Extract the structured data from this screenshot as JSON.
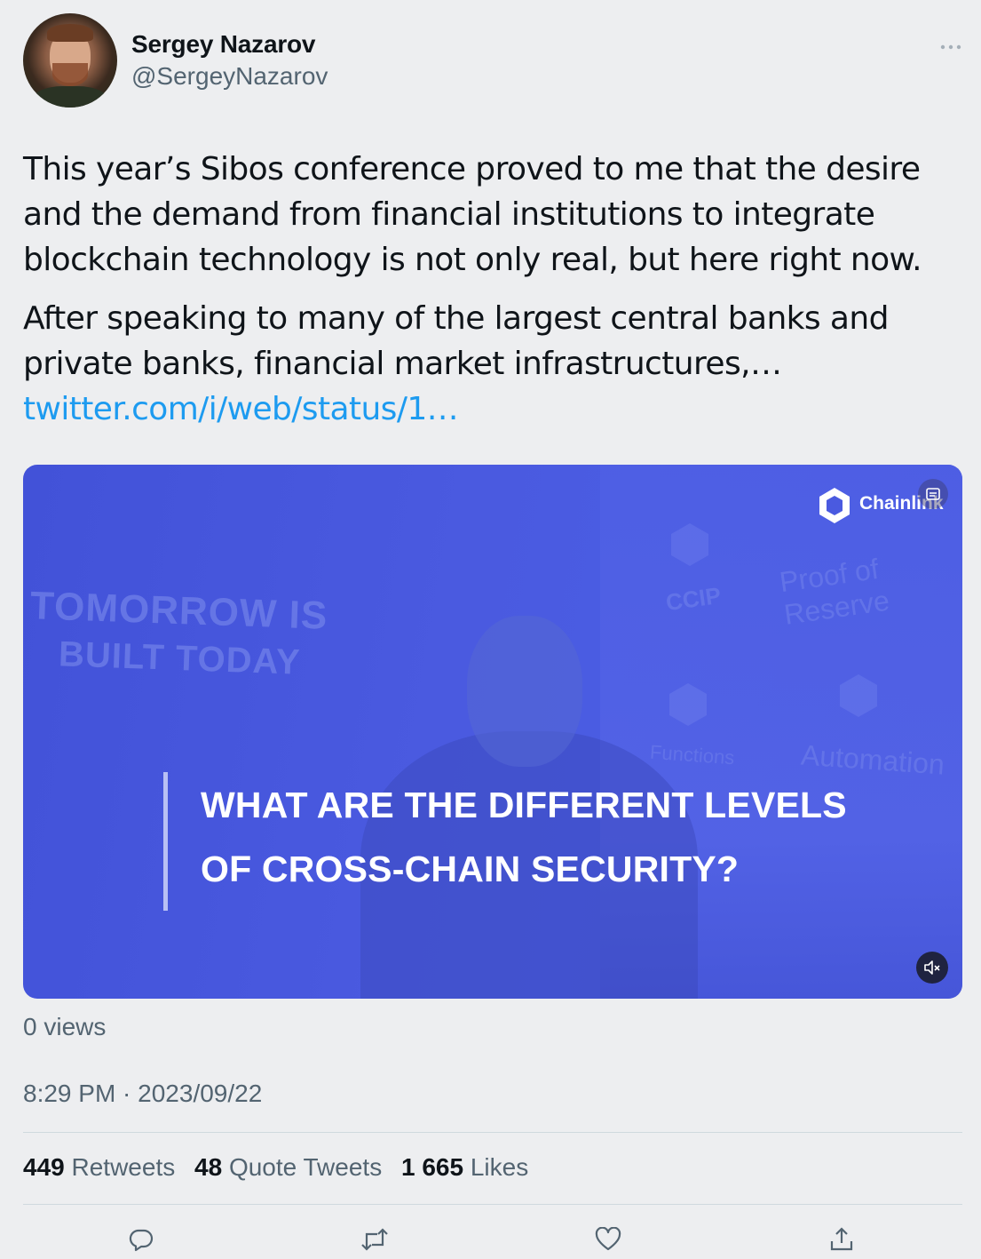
{
  "author": {
    "display_name": "Sergey Nazarov",
    "handle": "@SergeyNazarov"
  },
  "tweet": {
    "paragraph1": "This year’s Sibos conference proved to me that the desire and the demand from financial institutions to integrate blockchain technology is not only real, but here right now.",
    "paragraph2_text": "After speaking to many of the largest central banks and private banks, financial market infrastructures,… ",
    "paragraph2_link": "twitter.com/i/web/status/1…"
  },
  "media": {
    "background_text": {
      "line1": "TOMORROW IS",
      "line2": "BUILT TODAY",
      "ccip": "CCIP",
      "proof_of_reserve": "Proof of Reserve",
      "functions": "Functions",
      "automation": "Automation"
    },
    "brand": "Chainlink",
    "caption_line1": "WHAT ARE THE DIFFERENT LEVELS",
    "caption_line2": "OF CROSS-CHAIN SECURITY?",
    "muted": true
  },
  "views": "0 views",
  "timestamp": "8:29 PM · 2023/09/22",
  "stats": {
    "retweets_count": "449",
    "retweets_label": "Retweets",
    "quotes_count": "48",
    "quotes_label": "Quote Tweets",
    "likes_count": "1 665",
    "likes_label": "Likes"
  },
  "icons": {
    "more": "more-horizontal-icon",
    "reply": "reply-icon",
    "retweet": "retweet-icon",
    "like": "heart-icon",
    "share": "share-icon",
    "mute": "volume-muted-icon",
    "captions": "captions-icon"
  },
  "colors": {
    "link": "#1d9bf0",
    "secondary_text": "#536471",
    "media_blue": "#4a5ae0",
    "icon_gray": "#536471"
  }
}
